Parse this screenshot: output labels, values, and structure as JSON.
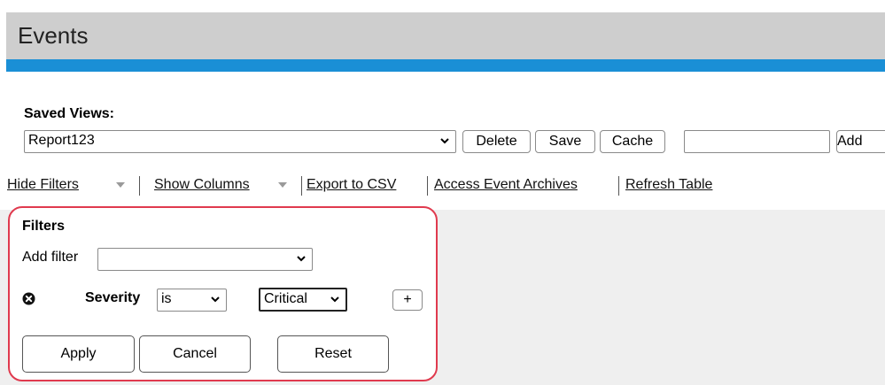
{
  "header": {
    "title": "Events",
    "accent_color": "#1a8fd6"
  },
  "saved_views": {
    "label": "Saved Views:",
    "selected": "Report123",
    "delete_label": "Delete",
    "save_label": "Save",
    "cache_label": "Cache",
    "new_view_value": "",
    "add_label": "Add"
  },
  "toolbar": {
    "hide_filters": "Hide Filters",
    "show_columns": "Show Columns",
    "export_csv": "Export to CSV",
    "access_archives": "Access Event Archives",
    "refresh_table": "Refresh Table"
  },
  "filters": {
    "title": "Filters",
    "add_filter_label": "Add filter",
    "add_filter_value": "",
    "rows": [
      {
        "field": "Severity",
        "operator": "is",
        "value": "Critical",
        "add_label": "+"
      }
    ],
    "apply_label": "Apply",
    "cancel_label": "Cancel",
    "reset_label": "Reset",
    "highlight_color": "#e03a4e"
  }
}
